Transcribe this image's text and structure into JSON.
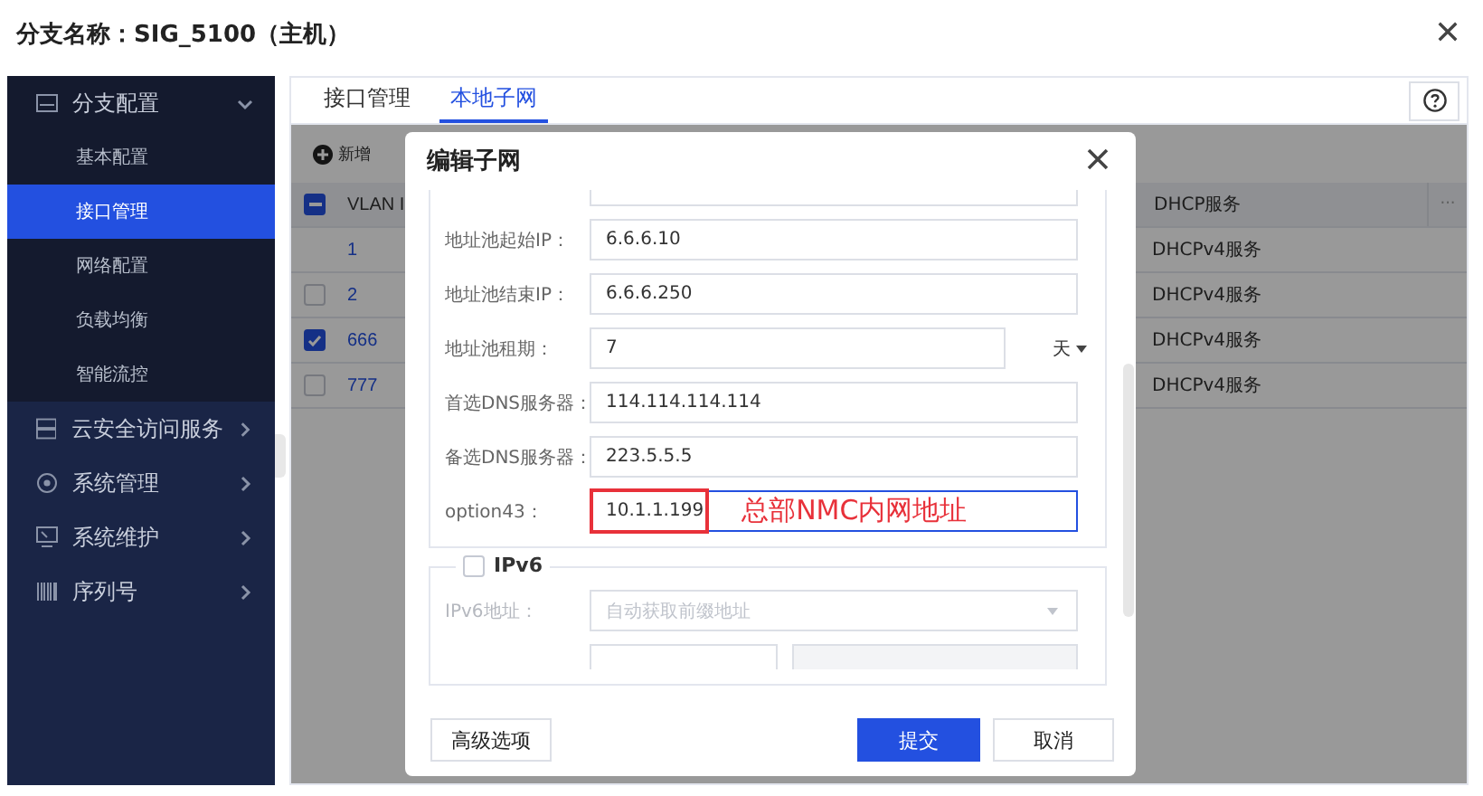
{
  "header": {
    "title": "分支名称：SIG_5100（主机）"
  },
  "sidebar": [
    {
      "label": "分支配置",
      "expanded": true,
      "children": [
        {
          "label": "基本配置",
          "selected": false
        },
        {
          "label": "接口管理",
          "selected": true
        },
        {
          "label": "网络配置",
          "selected": false
        },
        {
          "label": "负载均衡",
          "selected": false
        },
        {
          "label": "智能流控",
          "selected": false
        }
      ]
    },
    {
      "label": "云安全访问服务",
      "expanded": false
    },
    {
      "label": "系统管理",
      "expanded": false
    },
    {
      "label": "系统维护",
      "expanded": false
    },
    {
      "label": "序列号",
      "expanded": false
    }
  ],
  "tabs": [
    {
      "label": "接口管理",
      "selected": false
    },
    {
      "label": "本地子网",
      "selected": true
    }
  ],
  "toolbar": {
    "add_button": "新增"
  },
  "table": {
    "select_all_partial": true,
    "columns": [
      "VLAN I",
      "DHCP服务"
    ],
    "more": "···",
    "rows": [
      {
        "kind": "plain",
        "vlan": "1",
        "dhcp": "DHCPv4服务"
      },
      {
        "kind": "checkable",
        "vlan": "2",
        "dhcp": "DHCPv4服务",
        "checked": false
      },
      {
        "kind": "checkable",
        "vlan": "666",
        "dhcp": "DHCPv4服务",
        "checked": true
      },
      {
        "kind": "checkable",
        "vlan": "777",
        "dhcp": "DHCPv4服务",
        "checked": false
      }
    ]
  },
  "dialog": {
    "title": "编辑子网",
    "fields": [
      {
        "kind": "text",
        "label": "地址池起始IP：",
        "value": "6.6.6.10"
      },
      {
        "kind": "text",
        "label": "地址池结束IP：",
        "value": "6.6.6.250"
      },
      {
        "kind": "unit",
        "label": "地址池租期：",
        "value": "7",
        "unit": "天"
      },
      {
        "kind": "text",
        "label": "首选DNS服务器：",
        "value": "114.114.114.114"
      },
      {
        "kind": "text",
        "label": "备选DNS服务器：",
        "value": "223.5.5.5"
      },
      {
        "kind": "annotated",
        "label": "option43：",
        "value": "10.1.1.199",
        "annotation": "总部NMC内网地址"
      }
    ],
    "ipv6": {
      "label": "IPv6",
      "checked": false,
      "fields": [
        {
          "label": "IPv6地址：",
          "placeholder": "自动获取前缀地址",
          "disabled": true
        }
      ]
    },
    "buttons": [
      {
        "label": "高级选项",
        "kind": "default"
      },
      {
        "label": "提交",
        "kind": "primary"
      },
      {
        "label": "取消",
        "kind": "default"
      }
    ]
  }
}
